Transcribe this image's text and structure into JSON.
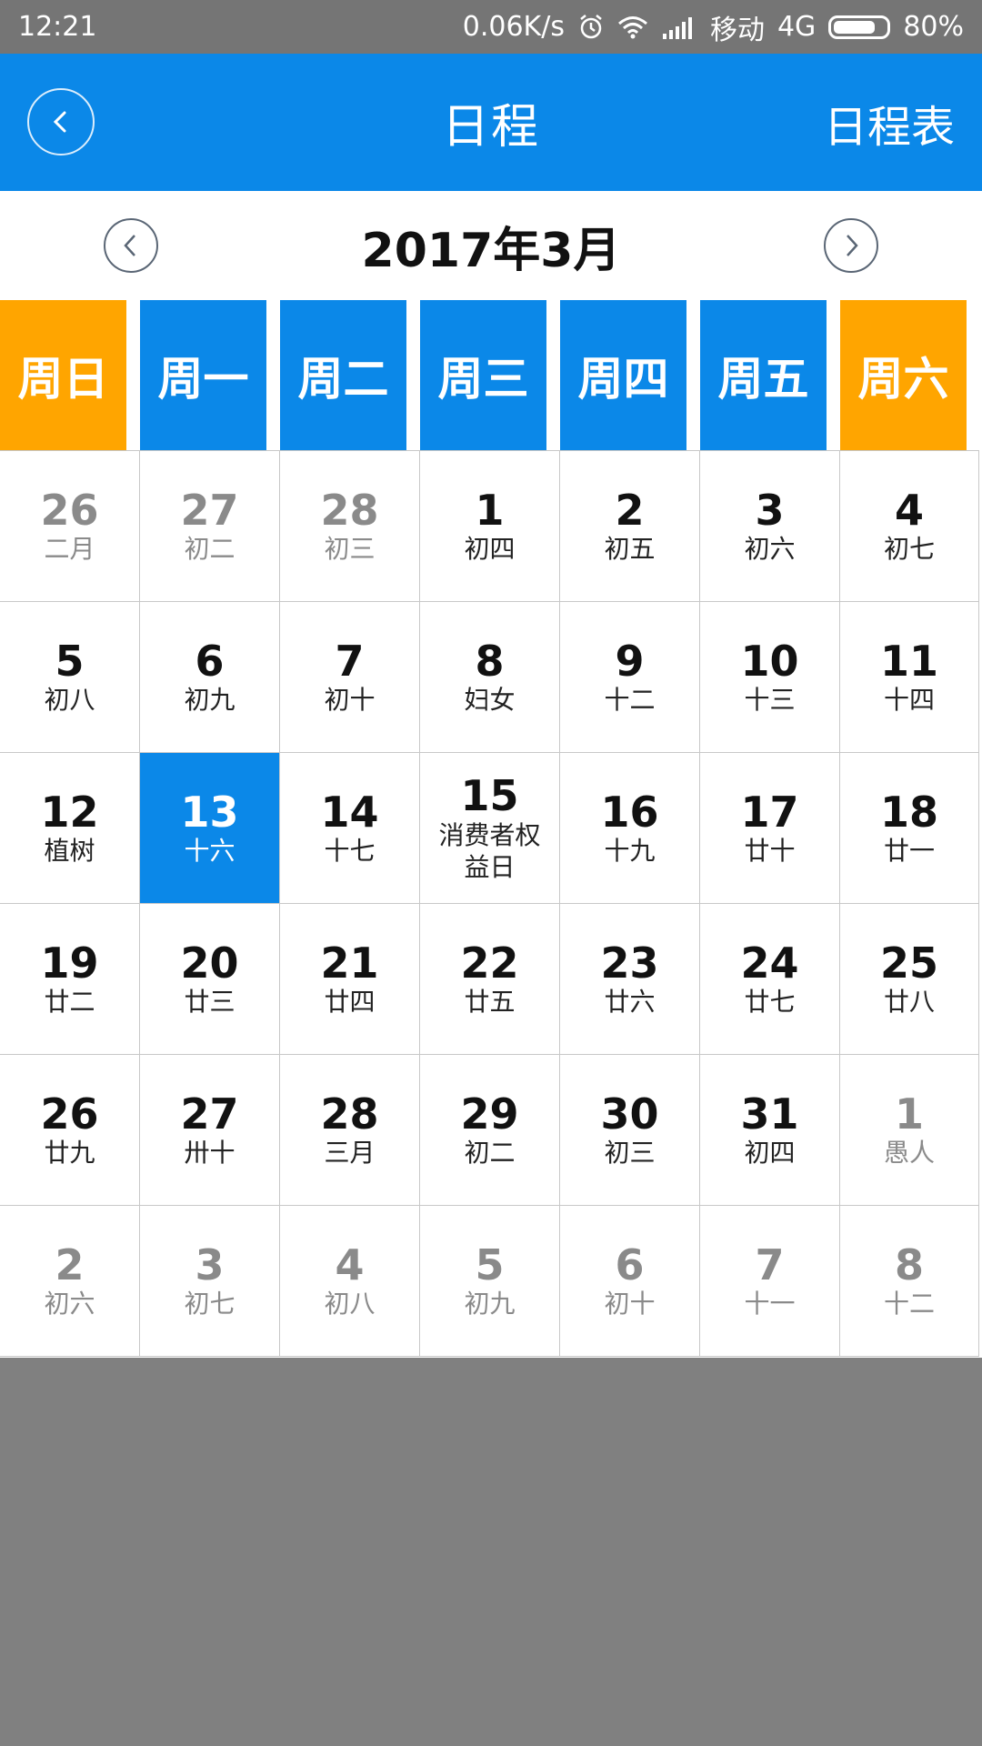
{
  "status_bar": {
    "time": "12:21",
    "speed": "0.06K/s",
    "carrier": "移动",
    "network": "4G",
    "battery": "80%",
    "battery_level": 0.8
  },
  "header": {
    "back_icon": "chevron-left-icon",
    "title": "日程",
    "action": "日程表"
  },
  "calendar": {
    "month_label": "2017年3月",
    "weekdays": [
      {
        "label": "周日",
        "color": "#FFA500"
      },
      {
        "label": "周一",
        "color": "#0B88E8"
      },
      {
        "label": "周二",
        "color": "#0B88E8"
      },
      {
        "label": "周三",
        "color": "#0B88E8"
      },
      {
        "label": "周四",
        "color": "#0B88E8"
      },
      {
        "label": "周五",
        "color": "#0B88E8"
      },
      {
        "label": "周六",
        "color": "#FFA500"
      }
    ],
    "weeks": [
      [
        {
          "day": "26",
          "lunar": "二月",
          "dim": true
        },
        {
          "day": "27",
          "lunar": "初二",
          "dim": true
        },
        {
          "day": "28",
          "lunar": "初三",
          "dim": true
        },
        {
          "day": "1",
          "lunar": "初四"
        },
        {
          "day": "2",
          "lunar": "初五"
        },
        {
          "day": "3",
          "lunar": "初六"
        },
        {
          "day": "4",
          "lunar": "初七"
        }
      ],
      [
        {
          "day": "5",
          "lunar": "初八"
        },
        {
          "day": "6",
          "lunar": "初九"
        },
        {
          "day": "7",
          "lunar": "初十"
        },
        {
          "day": "8",
          "lunar": "妇女"
        },
        {
          "day": "9",
          "lunar": "十二"
        },
        {
          "day": "10",
          "lunar": "十三"
        },
        {
          "day": "11",
          "lunar": "十四"
        }
      ],
      [
        {
          "day": "12",
          "lunar": "植树"
        },
        {
          "day": "13",
          "lunar": "十六",
          "selected": true
        },
        {
          "day": "14",
          "lunar": "十七"
        },
        {
          "day": "15",
          "lunar": "消费者权益日",
          "wrap": true
        },
        {
          "day": "16",
          "lunar": "十九"
        },
        {
          "day": "17",
          "lunar": "廿十"
        },
        {
          "day": "18",
          "lunar": "廿一"
        }
      ],
      [
        {
          "day": "19",
          "lunar": "廿二"
        },
        {
          "day": "20",
          "lunar": "廿三"
        },
        {
          "day": "21",
          "lunar": "廿四"
        },
        {
          "day": "22",
          "lunar": "廿五"
        },
        {
          "day": "23",
          "lunar": "廿六"
        },
        {
          "day": "24",
          "lunar": "廿七"
        },
        {
          "day": "25",
          "lunar": "廿八"
        }
      ],
      [
        {
          "day": "26",
          "lunar": "廿九"
        },
        {
          "day": "27",
          "lunar": "卅十"
        },
        {
          "day": "28",
          "lunar": "三月"
        },
        {
          "day": "29",
          "lunar": "初二"
        },
        {
          "day": "30",
          "lunar": "初三"
        },
        {
          "day": "31",
          "lunar": "初四"
        },
        {
          "day": "1",
          "lunar": "愚人",
          "dim": true
        }
      ],
      [
        {
          "day": "2",
          "lunar": "初六",
          "dim": true
        },
        {
          "day": "3",
          "lunar": "初七",
          "dim": true
        },
        {
          "day": "4",
          "lunar": "初八",
          "dim": true
        },
        {
          "day": "5",
          "lunar": "初九",
          "dim": true
        },
        {
          "day": "6",
          "lunar": "初十",
          "dim": true
        },
        {
          "day": "7",
          "lunar": "十一",
          "dim": true
        },
        {
          "day": "8",
          "lunar": "十二",
          "dim": true
        }
      ]
    ]
  }
}
